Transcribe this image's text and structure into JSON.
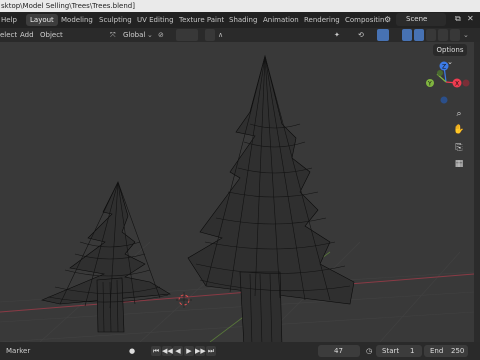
{
  "title_bar": {
    "path": "sktop\\Model Selling\\Trees\\Trees.blend]"
  },
  "top_menu": {
    "help": "Help"
  },
  "workspaces": [
    "Layout",
    "Modeling",
    "Sculpting",
    "UV Editing",
    "Texture Paint",
    "Shading",
    "Animation",
    "Rendering",
    "Compositin"
  ],
  "scene": {
    "label": "Scene"
  },
  "header": {
    "select": "elect",
    "add": "Add",
    "object": "Object",
    "transform": "Global",
    "options": "Options"
  },
  "gizmo": {
    "x": "X",
    "y": "Y",
    "z": "Z"
  },
  "timeline": {
    "marker": "Marker",
    "current_frame": "47",
    "start_label": "Start",
    "start": "1",
    "end_label": "End",
    "end": "250"
  },
  "colors": {
    "accent": "#4772b3",
    "x_axis": "#f03c50",
    "y_axis": "#80b540",
    "z_axis": "#3c7be8",
    "active_tab": "#3d3d3d"
  }
}
